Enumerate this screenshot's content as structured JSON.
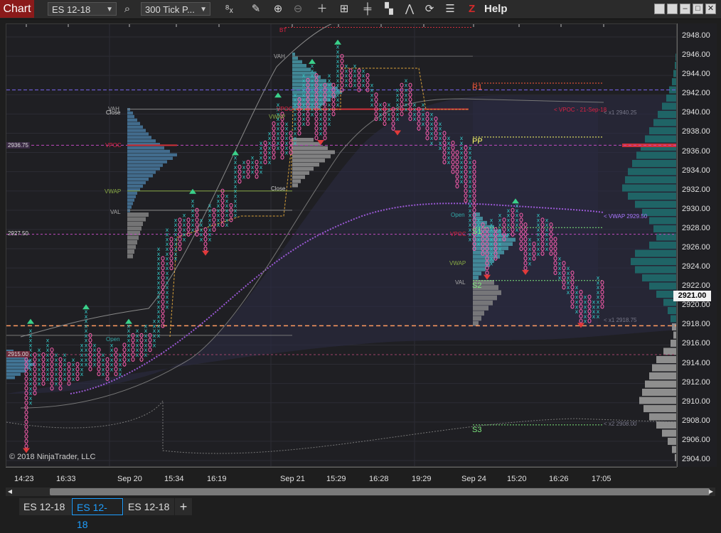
{
  "toolbar": {
    "chart_label": "Chart",
    "instrument": "ES 12-18",
    "bar_type": "300 Tick P...",
    "help": "Help",
    "brand_logo": "Z",
    "icons": [
      "search-icon",
      "data-series-icon",
      "draw-pencil-icon",
      "zoom-in-icon",
      "zoom-out-icon",
      "crosshair-icon",
      "data-box-icon",
      "bar-style-icon",
      "strategies-icon",
      "indicators-icon",
      "refresh-icon",
      "properties-icon"
    ]
  },
  "price_axis": {
    "ticks": [
      "2948.00",
      "2946.00",
      "2944.00",
      "2942.00",
      "2940.00",
      "2938.00",
      "2936.00",
      "2934.00",
      "2932.00",
      "2930.00",
      "2928.00",
      "2926.00",
      "2924.00",
      "2922.00",
      "2920.00",
      "2918.00",
      "2916.00",
      "2914.00",
      "2912.00",
      "2910.00",
      "2908.00",
      "2906.00",
      "2904.00"
    ],
    "current_price": "2921.00"
  },
  "time_axis": {
    "ticks": [
      "14:23",
      "16:33",
      "Sep 20",
      "15:34",
      "16:19",
      "Sep 21",
      "15:29",
      "16:28",
      "19:29",
      "Sep 24",
      "15:20",
      "16:26",
      "17:05"
    ]
  },
  "chart": {
    "copyright": "© 2018 NinjaTrader, LLC",
    "left_markers": [
      "2936.75",
      "2927.50",
      "2915.00"
    ],
    "profile_labels": [
      "BT",
      "VAH",
      "VAH",
      "Close",
      "VPOC",
      "VWAP",
      "VAL",
      "Close",
      "VPOC",
      "VWAP",
      "Open",
      "Open",
      "VPOC",
      "VWAP",
      "VAL"
    ],
    "pivots": [
      "R1",
      "PP",
      "S1",
      "S2",
      "S3"
    ],
    "right_notes": [
      "< VPOC - 21-Sep-18",
      "< x1 2940.25",
      "< VWAP 2929.50",
      "< x1 2918.75",
      "< x2 2908.00"
    ]
  },
  "colors": {
    "x_box": "#34c3c3",
    "o_box": "#f05aa8",
    "vwap": "#9b59d6",
    "pivot_r": "#ff5a3a",
    "pivot_pp": "#ffff66",
    "pivot_s": "#7de87d",
    "dashed_orange": "#ff9a60"
  },
  "tabs": [
    "ES 12-18",
    "ES 12-18",
    "ES 12-18"
  ],
  "add_tab": "+"
}
